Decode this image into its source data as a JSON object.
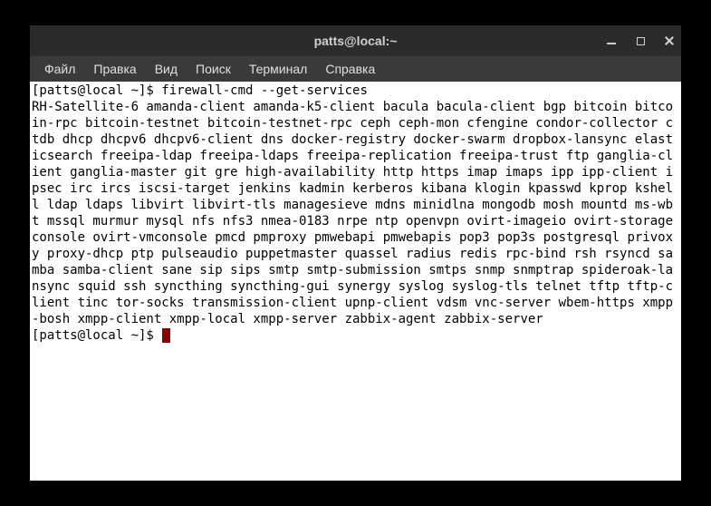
{
  "titlebar": {
    "title": "patts@local:~"
  },
  "menubar": {
    "items": [
      {
        "label": "Файл"
      },
      {
        "label": "Правка"
      },
      {
        "label": "Вид"
      },
      {
        "label": "Поиск"
      },
      {
        "label": "Терминал"
      },
      {
        "label": "Справка"
      }
    ]
  },
  "terminal": {
    "prompt1": "[patts@local ~]$ ",
    "command1": "firewall-cmd --get-services",
    "output": "RH-Satellite-6 amanda-client amanda-k5-client bacula bacula-client bgp bitcoin bitcoin-rpc bitcoin-testnet bitcoin-testnet-rpc ceph ceph-mon cfengine condor-collector ctdb dhcp dhcpv6 dhcpv6-client dns docker-registry docker-swarm dropbox-lansync elasticsearch freeipa-ldap freeipa-ldaps freeipa-replication freeipa-trust ftp ganglia-client ganglia-master git gre high-availability http https imap imaps ipp ipp-client ipsec irc ircs iscsi-target jenkins kadmin kerberos kibana klogin kpasswd kprop kshell ldap ldaps libvirt libvirt-tls managesieve mdns minidlna mongodb mosh mountd ms-wbt mssql murmur mysql nfs nfs3 nmea-0183 nrpe ntp openvpn ovirt-imageio ovirt-storageconsole ovirt-vmconsole pmcd pmproxy pmwebapi pmwebapis pop3 pop3s postgresql privoxy proxy-dhcp ptp pulseaudio puppetmaster quassel radius redis rpc-bind rsh rsyncd samba samba-client sane sip sips smtp smtp-submission smtps snmp snmptrap spideroak-lansync squid ssh syncthing syncthing-gui synergy syslog syslog-tls telnet tftp tftp-client tinc tor-socks transmission-client upnp-client vdsm vnc-server wbem-https xmpp-bosh xmpp-client xmpp-local xmpp-server zabbix-agent zabbix-server",
    "prompt2": "[patts@local ~]$ "
  }
}
